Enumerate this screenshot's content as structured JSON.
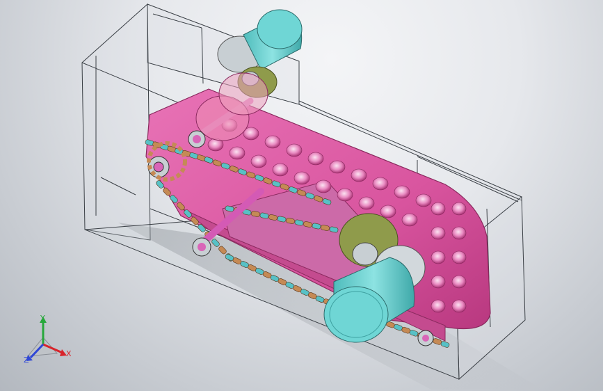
{
  "viewport": {
    "background_top": "#f4f5f7",
    "background_bottom": "#b3b8bf"
  },
  "model": {
    "parts": [
      "transparent-housing",
      "pink-crawler-track-body",
      "roller-chain",
      "sprocket",
      "bearing",
      "shaft",
      "motor",
      "gear"
    ],
    "colors": {
      "track_body": "#d9559f",
      "track_body_dark": "#b8387f",
      "chain_link": "#c58a55",
      "chain_pin": "#57c1c6",
      "motor": "#66d2d1",
      "gear": "#8f9b4b",
      "bearing": "#c8cfd3",
      "housing_edge": "#3a3f45"
    }
  },
  "triad": {
    "x_label": "X",
    "y_label": "Y",
    "z_label": "Z",
    "x_color": "#d8232a",
    "y_color": "#27a83b",
    "z_color": "#2f47d6"
  }
}
